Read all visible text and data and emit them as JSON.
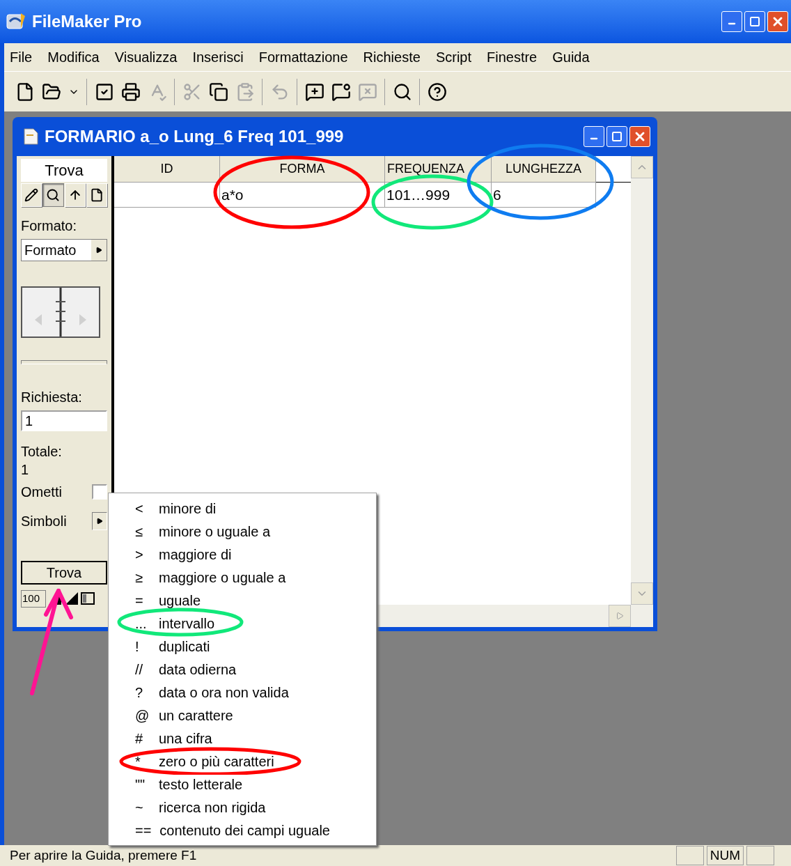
{
  "window": {
    "title": "FileMaker Pro"
  },
  "menu_bar": [
    "File",
    "Modifica",
    "Visualizza",
    "Inserisci",
    "Formattazione",
    "Richieste",
    "Script",
    "Finestre",
    "Guida"
  ],
  "toolbar_groups": [
    [
      {
        "kind": "new",
        "disabled": false
      },
      {
        "kind": "open",
        "disabled": false
      },
      {
        "kind": "caret",
        "disabled": false
      }
    ],
    [
      {
        "kind": "check",
        "disabled": false
      },
      {
        "kind": "print",
        "disabled": false
      },
      {
        "kind": "spell",
        "disabled": true
      }
    ],
    [
      {
        "kind": "cut",
        "disabled": true
      },
      {
        "kind": "copy",
        "disabled": false
      },
      {
        "kind": "paste",
        "disabled": true
      }
    ],
    [
      {
        "kind": "undo",
        "disabled": true
      }
    ],
    [
      {
        "kind": "newreq",
        "disabled": false
      },
      {
        "kind": "dupreq",
        "disabled": false
      },
      {
        "kind": "delreq",
        "disabled": true
      }
    ],
    [
      {
        "kind": "find",
        "disabled": false
      }
    ],
    [
      {
        "kind": "help",
        "disabled": false
      }
    ]
  ],
  "document": {
    "title": "FORMARIO a_o Lung_6 Freq 101_999",
    "mode_label": "Trova",
    "modes": [
      {
        "kind": "browse",
        "selected": false
      },
      {
        "kind": "find",
        "selected": true
      },
      {
        "kind": "layout",
        "selected": false
      },
      {
        "kind": "preview",
        "selected": false
      }
    ],
    "format_label": "Formato:",
    "format_value": "Formato",
    "request_label": "Richiesta:",
    "request_value": "1",
    "total_label": "Totale:",
    "total_value": "1",
    "omit": {
      "label": "Ometti",
      "checked": false
    },
    "symbols_label": "Simboli",
    "find_button": "Trova",
    "zoom": "100",
    "table": {
      "columns": [
        "ID",
        "FORMA",
        "FREQUENZA",
        "LUNGHEZZA"
      ],
      "rows": [
        [
          null,
          "a*o",
          "101…999",
          "6"
        ]
      ]
    }
  },
  "symbols_menu": [
    {
      "symbol": "<",
      "label": "minore di"
    },
    {
      "symbol": "≤",
      "label": "minore o uguale a"
    },
    {
      "symbol": ">",
      "label": "maggiore di"
    },
    {
      "symbol": "≥",
      "label": "maggiore o uguale a"
    },
    {
      "symbol": "=",
      "label": "uguale"
    },
    {
      "symbol": "...",
      "label": "intervallo"
    },
    {
      "symbol": "!",
      "label": "duplicati"
    },
    {
      "symbol": "//",
      "label": "data odierna"
    },
    {
      "symbol": "?",
      "label": "data o ora non valida"
    },
    {
      "symbol": "@",
      "label": "un carattere"
    },
    {
      "symbol": "#",
      "label": "una cifra"
    },
    {
      "symbol": "*",
      "label": "zero o più caratteri"
    },
    {
      "symbol": "\"\"",
      "label": "testo letterale"
    },
    {
      "symbol": "~",
      "label": "ricerca non rigida"
    },
    {
      "symbol": "==",
      "label": "contenuto dei campi uguale"
    }
  ],
  "status_bar": {
    "text": "Per aprire la Guida, premere F1",
    "indicator": "NUM"
  }
}
